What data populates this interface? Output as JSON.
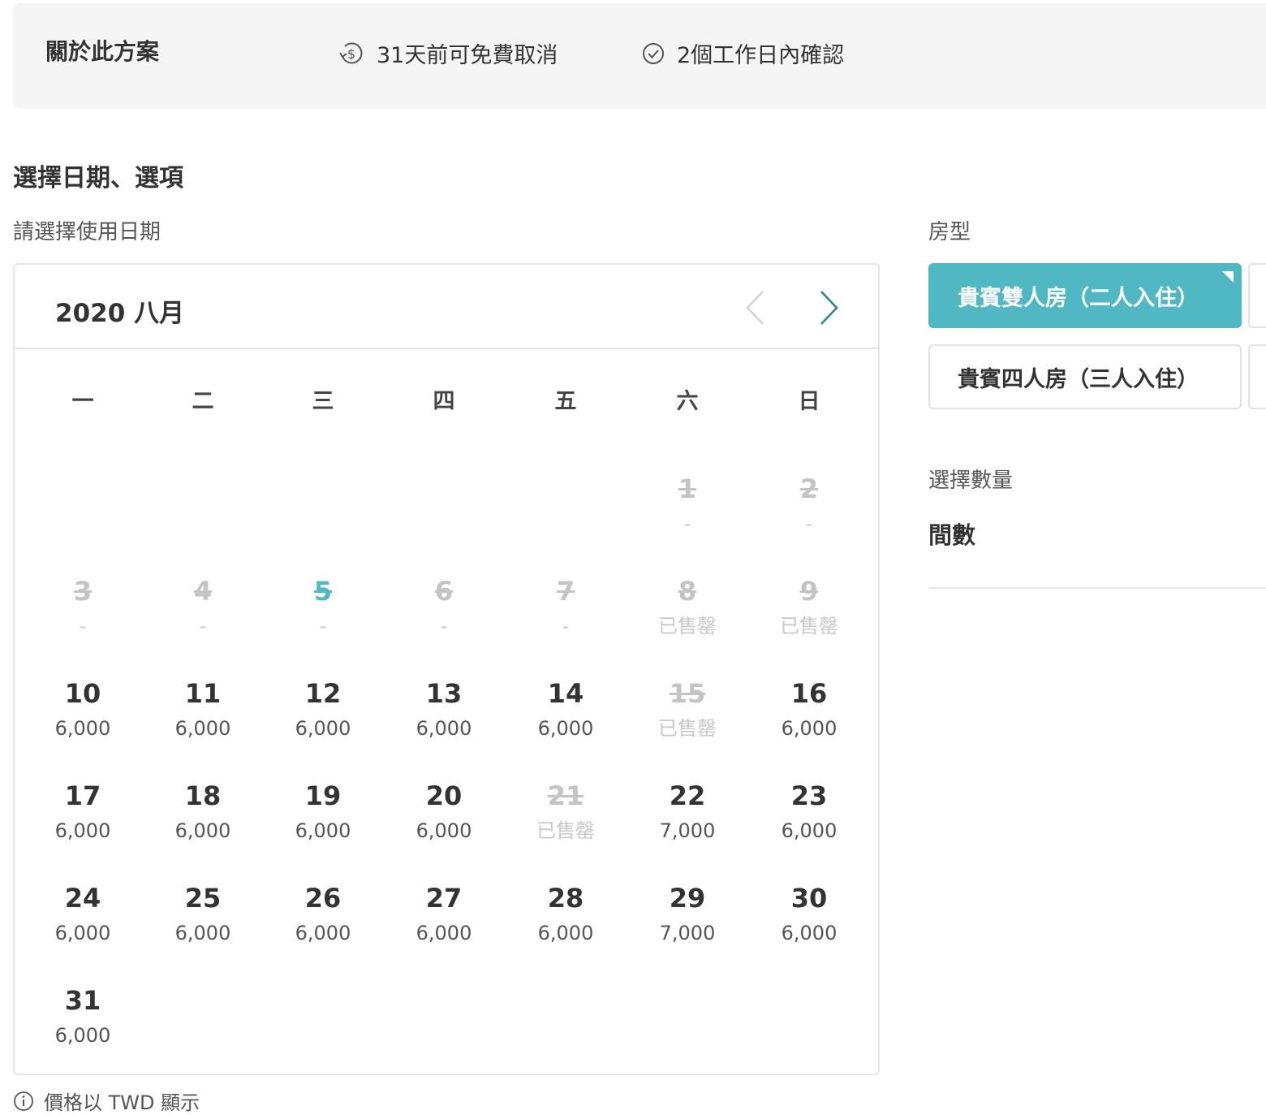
{
  "info_bar": {
    "title": "關於此方案",
    "cancel_policy": "31天前可免費取消",
    "confirm_policy": "2個工作日內確認"
  },
  "section_title": "選擇日期、選項",
  "date_label": "請選擇使用日期",
  "calendar": {
    "month_title": "2020 八月",
    "weekdays": [
      "一",
      "二",
      "三",
      "四",
      "五",
      "六",
      "日"
    ],
    "days": [
      {
        "day": "1",
        "price": "-",
        "status": "disabled",
        "col": 5,
        "row": 0
      },
      {
        "day": "2",
        "price": "-",
        "status": "disabled",
        "col": 6,
        "row": 0
      },
      {
        "day": "3",
        "price": "-",
        "status": "disabled",
        "col": 0,
        "row": 1
      },
      {
        "day": "4",
        "price": "-",
        "status": "disabled",
        "col": 1,
        "row": 1
      },
      {
        "day": "5",
        "price": "-",
        "status": "today",
        "col": 2,
        "row": 1
      },
      {
        "day": "6",
        "price": "-",
        "status": "disabled",
        "col": 3,
        "row": 1
      },
      {
        "day": "7",
        "price": "-",
        "status": "disabled",
        "col": 4,
        "row": 1
      },
      {
        "day": "8",
        "price": "已售罄",
        "status": "disabled",
        "col": 5,
        "row": 1
      },
      {
        "day": "9",
        "price": "已售罄",
        "status": "disabled",
        "col": 6,
        "row": 1
      },
      {
        "day": "10",
        "price": "6,000",
        "status": "available",
        "col": 0,
        "row": 2
      },
      {
        "day": "11",
        "price": "6,000",
        "status": "available",
        "col": 1,
        "row": 2
      },
      {
        "day": "12",
        "price": "6,000",
        "status": "available",
        "col": 2,
        "row": 2
      },
      {
        "day": "13",
        "price": "6,000",
        "status": "available",
        "col": 3,
        "row": 2
      },
      {
        "day": "14",
        "price": "6,000",
        "status": "available",
        "col": 4,
        "row": 2
      },
      {
        "day": "15",
        "price": "已售罄",
        "status": "disabled",
        "col": 5,
        "row": 2
      },
      {
        "day": "16",
        "price": "6,000",
        "status": "available",
        "col": 6,
        "row": 2
      },
      {
        "day": "17",
        "price": "6,000",
        "status": "available",
        "col": 0,
        "row": 3
      },
      {
        "day": "18",
        "price": "6,000",
        "status": "available",
        "col": 1,
        "row": 3
      },
      {
        "day": "19",
        "price": "6,000",
        "status": "available",
        "col": 2,
        "row": 3
      },
      {
        "day": "20",
        "price": "6,000",
        "status": "available",
        "col": 3,
        "row": 3
      },
      {
        "day": "21",
        "price": "已售罄",
        "status": "disabled",
        "col": 4,
        "row": 3
      },
      {
        "day": "22",
        "price": "7,000",
        "status": "available",
        "col": 5,
        "row": 3
      },
      {
        "day": "23",
        "price": "6,000",
        "status": "available",
        "col": 6,
        "row": 3
      },
      {
        "day": "24",
        "price": "6,000",
        "status": "available",
        "col": 0,
        "row": 4
      },
      {
        "day": "25",
        "price": "6,000",
        "status": "available",
        "col": 1,
        "row": 4
      },
      {
        "day": "26",
        "price": "6,000",
        "status": "available",
        "col": 2,
        "row": 4
      },
      {
        "day": "27",
        "price": "6,000",
        "status": "available",
        "col": 3,
        "row": 4
      },
      {
        "day": "28",
        "price": "6,000",
        "status": "available",
        "col": 4,
        "row": 4
      },
      {
        "day": "29",
        "price": "7,000",
        "status": "available",
        "col": 5,
        "row": 4
      },
      {
        "day": "30",
        "price": "6,000",
        "status": "available",
        "col": 6,
        "row": 4
      },
      {
        "day": "31",
        "price": "6,000",
        "status": "available",
        "col": 0,
        "row": 5
      }
    ]
  },
  "price_note": "價格以 TWD 顯示",
  "room_type": {
    "label": "房型",
    "options": [
      {
        "label": "貴賓雙人房（二人入住）",
        "selected": true
      },
      {
        "label": "貴賓四人房（三人入住）",
        "selected": false
      }
    ]
  },
  "quantity": {
    "label": "選擇數量",
    "rooms_label": "間數"
  },
  "colors": {
    "accent": "#4fb8c3",
    "disabled_text": "#c4c4c4",
    "panel_bg": "#f5f5f5",
    "border": "#e6e6e6"
  },
  "icons": {
    "cancel": "refund-icon",
    "confirm": "check-circle-icon",
    "note": "info-icon",
    "prev": "chevron-left-icon",
    "next": "chevron-right-icon"
  }
}
